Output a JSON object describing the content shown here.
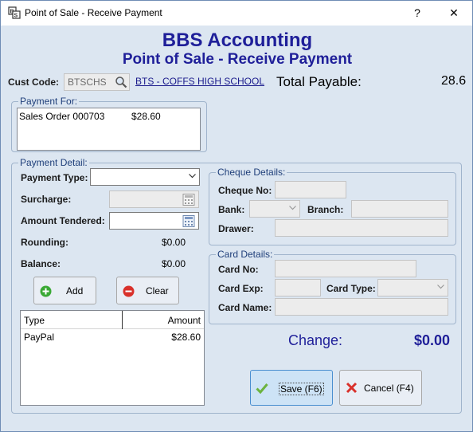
{
  "window": {
    "title": "Point of Sale - Receive Payment",
    "help_label": "?",
    "close_label": "✕"
  },
  "header": {
    "company": "BBS Accounting",
    "subtitle": "Point of Sale - Receive Payment"
  },
  "customer": {
    "code_label": "Cust Code:",
    "code_value": "BTSCHS",
    "name_link": "BTS - COFFS HIGH SCHOOL",
    "total_label": "Total Payable:",
    "total_value": "28.6"
  },
  "payment_for": {
    "title": "Payment For:",
    "items": [
      {
        "description": "Sales Order 000703",
        "amount": "$28.60"
      }
    ]
  },
  "payment_detail": {
    "title": "Payment Detail:",
    "payment_type_label": "Payment Type:",
    "payment_type_value": "",
    "surcharge_label": "Surcharge:",
    "amount_tendered_label": "Amount Tendered:",
    "rounding_label": "Rounding:",
    "rounding_value": "$0.00",
    "balance_label": "Balance:",
    "balance_value": "$0.00",
    "add_label": "Add",
    "clear_label": "Clear",
    "table": {
      "headers": [
        "Type",
        "Amount"
      ],
      "rows": [
        {
          "type": "PayPal",
          "amount": "$28.60"
        }
      ]
    }
  },
  "cheque": {
    "title": "Cheque Details:",
    "no_label": "Cheque No:",
    "bank_label": "Bank:",
    "branch_label": "Branch:",
    "drawer_label": "Drawer:"
  },
  "card": {
    "title": "Card Details:",
    "no_label": "Card No:",
    "exp_label": "Card Exp:",
    "type_label": "Card Type:",
    "name_label": "Card Name:"
  },
  "change": {
    "label": "Change:",
    "value": "$0.00"
  },
  "actions": {
    "save_label": "Save (F6)",
    "cancel_label": "Cancel (F4)"
  },
  "colors": {
    "accent": "#1f1f99",
    "window_bg": "#dce6f1",
    "add_icon": "#3aa935",
    "clear_icon": "#d9312b",
    "save_check": "#6cb33f"
  }
}
